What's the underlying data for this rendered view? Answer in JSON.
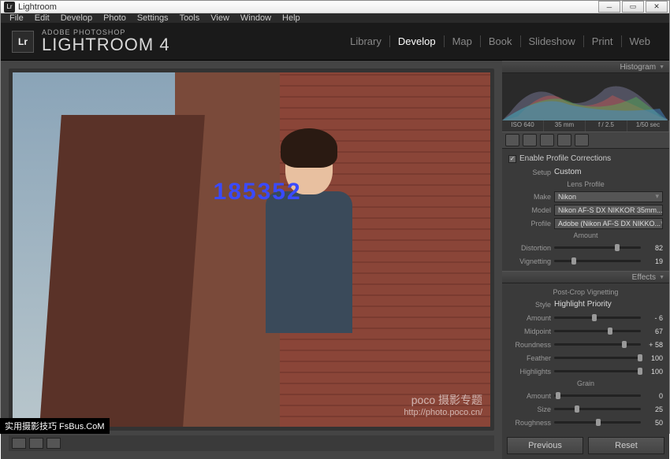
{
  "window": {
    "title": "Lightroom"
  },
  "menu": [
    "File",
    "Edit",
    "Develop",
    "Photo",
    "Settings",
    "Tools",
    "View",
    "Window",
    "Help"
  ],
  "brand": {
    "logo": "Lr",
    "small": "ADOBE PHOTOSHOP",
    "big": "LIGHTROOM 4"
  },
  "modules": [
    "Library",
    "Develop",
    "Map",
    "Book",
    "Slideshow",
    "Print",
    "Web"
  ],
  "active_module": "Develop",
  "histogram": {
    "title": "Histogram",
    "info": [
      "ISO 640",
      "35 mm",
      "f / 2.5",
      "1/50 sec"
    ]
  },
  "lens_panel": {
    "enable_label": "Enable Profile Corrections",
    "setup_label": "Setup",
    "setup_value": "Custom",
    "profile_title": "Lens Profile",
    "make_label": "Make",
    "make_value": "Nikon",
    "model_label": "Model",
    "model_value": "Nikon AF-S DX NIKKOR 35mm...",
    "profile_label": "Profile",
    "profile_value": "Adobe (Nikon AF-S DX NIKKO...",
    "amount_title": "Amount",
    "distortion": {
      "label": "Distortion",
      "value": "82",
      "pos": 70
    },
    "vignetting": {
      "label": "Vignetting",
      "value": "19",
      "pos": 20
    }
  },
  "effects": {
    "title": "Effects",
    "vignette_title": "Post-Crop Vignetting",
    "style_label": "Style",
    "style_value": "Highlight Priority",
    "amount": {
      "label": "Amount",
      "value": "- 6",
      "pos": 44
    },
    "midpoint": {
      "label": "Midpoint",
      "value": "67",
      "pos": 62
    },
    "roundness": {
      "label": "Roundness",
      "value": "+ 58",
      "pos": 78
    },
    "feather": {
      "label": "Feather",
      "value": "100",
      "pos": 96
    },
    "highlights": {
      "label": "Highlights",
      "value": "100",
      "pos": 96
    },
    "grain_title": "Grain",
    "grain_amount": {
      "label": "Amount",
      "value": "0",
      "pos": 2
    },
    "grain_size": {
      "label": "Size",
      "value": "25",
      "pos": 24
    },
    "grain_rough": {
      "label": "Roughness",
      "value": "50",
      "pos": 48
    }
  },
  "buttons": {
    "prev": "Previous",
    "reset": "Reset"
  },
  "watermark": {
    "line1": "poco 摄影专题",
    "line2": "http://photo.poco.cn/"
  },
  "footer": "实用摄影技巧 FsBus.CoM",
  "overlay_number": "185352"
}
